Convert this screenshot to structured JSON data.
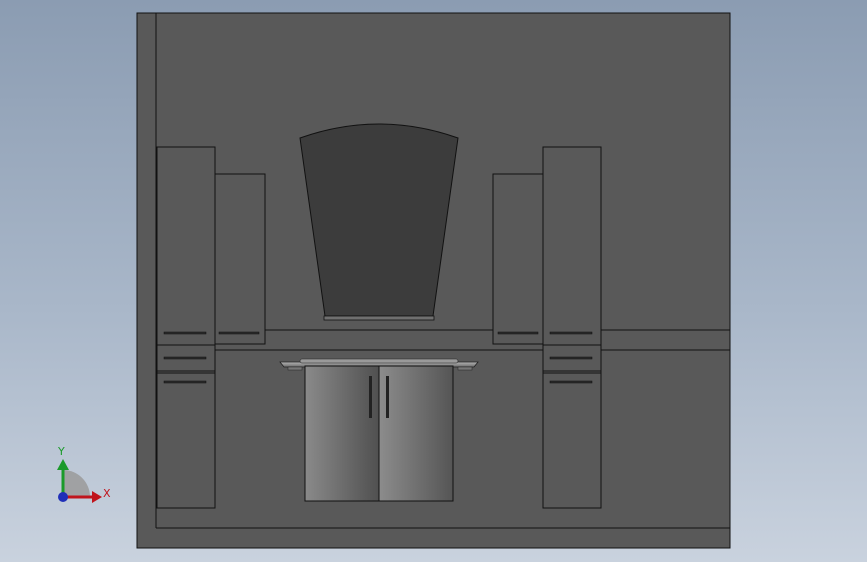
{
  "viewport": {
    "background_top": "#8b9cb2",
    "background_bottom": "#c9d2de"
  },
  "model": {
    "wall_color": "#595959",
    "cabinet_color": "#595959",
    "mirror_color": "#3c3c3c",
    "edge_color": "#111111",
    "door_gradient": [
      "#8a8a8a",
      "#505050"
    ]
  },
  "triad": {
    "x_label": "X",
    "y_label": "Y",
    "x_color": "#c0141c",
    "y_color": "#1a9a2a",
    "z_color": "#1f2fb8"
  }
}
